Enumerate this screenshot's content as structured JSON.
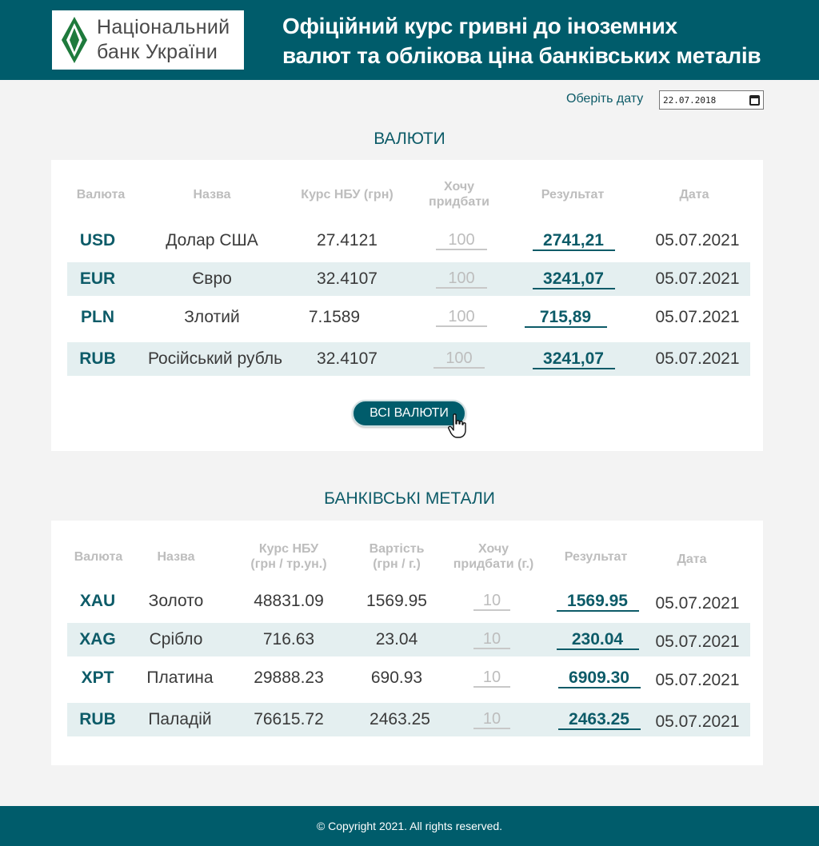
{
  "header": {
    "logo_line1": "Національний",
    "logo_line2": "банк України",
    "title_line1": "Офіційний курс гривні до іноземних",
    "title_line2": "валют та облікова ціна банківських металів"
  },
  "date_picker": {
    "label": "Оберіть дату",
    "value": "22.07.2018"
  },
  "currencies": {
    "title": "ВАЛЮТИ",
    "headers": {
      "code": "Валюта",
      "name": "Назва",
      "rate": "Курс НБУ (грн)",
      "want_l1": "Хочу",
      "want_l2": "придбати",
      "result": "Результат",
      "date": "Дата"
    },
    "rows": [
      {
        "code": "USD",
        "name": "Долар США",
        "rate": "27.4121",
        "qty": "100",
        "result": "2741,21",
        "date": "05.07.2021"
      },
      {
        "code": "EUR",
        "name": "Євро",
        "rate": "32.4107",
        "qty": "100",
        "result": "3241,07",
        "date": "05.07.2021"
      },
      {
        "code": "PLN",
        "name": "Злотий",
        "rate": "7.1589",
        "qty": "100",
        "result": "715,89",
        "date": "05.07.2021"
      },
      {
        "code": "RUB",
        "name": "Російський рубль",
        "rate": "32.4107",
        "qty": "100",
        "result": "3241,07",
        "date": "05.07.2021"
      }
    ],
    "all_button": "ВСІ ВАЛЮТИ"
  },
  "metals": {
    "title": "БАНКІВСЬКІ МЕТАЛИ",
    "headers": {
      "code": "Валюта",
      "name": "Назва",
      "rate_l1": "Курс НБУ",
      "rate_l2": "(грн / тр.ун.)",
      "cost_l1": "Вартість",
      "cost_l2": "(грн / г.)",
      "want_l1": "Хочу",
      "want_l2": "придбати (г.)",
      "result": "Результат",
      "date": "Дата"
    },
    "rows": [
      {
        "code": "XAU",
        "name": "Золото",
        "rate": "48831.09",
        "cost": "1569.95",
        "qty": "10",
        "result": "1569.95",
        "date": "05.07.2021"
      },
      {
        "code": "XAG",
        "name": "Срібло",
        "rate": "716.63",
        "cost": "23.04",
        "qty": "10",
        "result": "230.04",
        "date": "05.07.2021"
      },
      {
        "code": "XPT",
        "name": "Платина",
        "rate": "29888.23",
        "cost": "690.93",
        "qty": "10",
        "result": "6909.30",
        "date": "05.07.2021"
      },
      {
        "code": "RUB",
        "name": "Паладій",
        "rate": "76615.72",
        "cost": "2463.25",
        "qty": "10",
        "result": "2463.25",
        "date": "05.07.2021"
      }
    ]
  },
  "footer": {
    "copyright": "© Copyright 2021. All rights reserved."
  },
  "colors": {
    "brand": "#005c6b",
    "accent_text": "#0d5b68",
    "band": "#e4eff0"
  },
  "icons": {
    "logo": "nbu-emblem-icon",
    "calendar": "calendar-icon",
    "cursor": "hand-pointer-icon"
  }
}
